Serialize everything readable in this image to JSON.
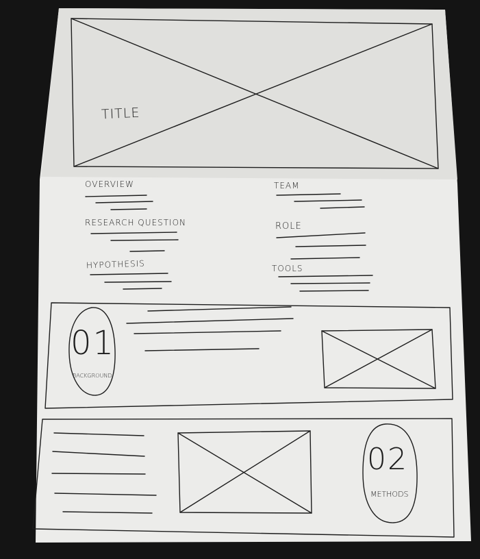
{
  "sketch": {
    "title": "TITLE",
    "left_column": [
      "OVERVIEW",
      "RESEARCH QUESTION",
      "HYPOTHESIS"
    ],
    "right_column": [
      "TEAM",
      "ROLE",
      "TOOLS"
    ],
    "section_1": {
      "number": "01",
      "label": "BACKGROUND"
    },
    "section_2": {
      "number": "02",
      "label": "METHODS"
    }
  },
  "colors": {
    "background": "#141414",
    "paper": "#ececea",
    "paper_shadow": "#dcdcd8",
    "ink": "#1d1d1d"
  }
}
